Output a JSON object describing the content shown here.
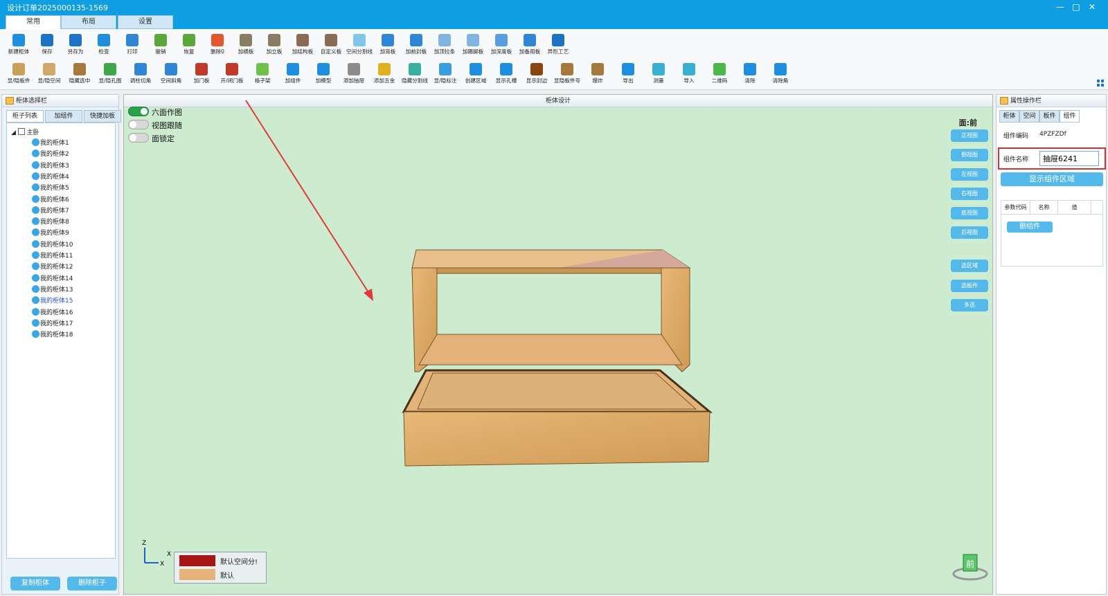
{
  "window": {
    "title": "设计订单2025000135-1569",
    "min": "—",
    "max": "□",
    "close": "✕"
  },
  "ribbon": {
    "tabs": [
      "常用",
      "布局",
      "设置"
    ],
    "row1": [
      {
        "label": "新建柜体",
        "color": "#1e8fe0"
      },
      {
        "label": "保存",
        "color": "#1b73c8"
      },
      {
        "label": "另存为",
        "color": "#1b73c8"
      },
      {
        "label": "检查",
        "color": "#1e8fe0"
      },
      {
        "label": "打印",
        "color": "#2f86d6"
      },
      {
        "label": "撤销",
        "color": "#5aa83a"
      },
      {
        "label": "恢复",
        "color": "#5aa83a"
      },
      {
        "label": "删除0",
        "color": "#e4572e"
      },
      {
        "label": "加横板",
        "color": "#8a7b63"
      },
      {
        "label": "加立板",
        "color": "#8a7b63"
      },
      {
        "label": "加结构板",
        "color": "#8a6b53"
      },
      {
        "label": "自定义板",
        "color": "#8a6b53"
      },
      {
        "label": "空间分割线",
        "color": "#7fc6ea"
      },
      {
        "label": "加背板",
        "color": "#2f86d6"
      },
      {
        "label": "加前封板",
        "color": "#2f86d6"
      },
      {
        "label": "加顶拉条",
        "color": "#7fb5e0"
      },
      {
        "label": "加踢脚板",
        "color": "#7fb5e0"
      },
      {
        "label": "加深度板",
        "color": "#5a9de0"
      },
      {
        "label": "加备用板",
        "color": "#2f86d6"
      },
      {
        "label": "异形工艺",
        "color": "#1b73c8"
      }
    ],
    "row2": [
      {
        "label": "显/隐板件",
        "color": "#c8a05a"
      },
      {
        "label": "显/隐空间",
        "color": "#d2a86a"
      },
      {
        "label": "隐藏选中",
        "color": "#a57a3e"
      },
      {
        "label": "显/隐孔图",
        "color": "#3ca84a"
      },
      {
        "label": "调柱切角",
        "color": "#2f86d6"
      },
      {
        "label": "空间斜角",
        "color": "#2f86d6"
      },
      {
        "label": "加门板",
        "color": "#c0392b"
      },
      {
        "label": "开/闭门板",
        "color": "#c0392b"
      },
      {
        "label": "格子架",
        "color": "#6ec14a"
      },
      {
        "label": "加组件",
        "color": "#1e8fe0"
      },
      {
        "label": "加模型",
        "color": "#1e8fe0"
      },
      {
        "label": "添加抽屉",
        "color": "#8c8c8c"
      },
      {
        "label": "添加五金",
        "color": "#e0b020"
      },
      {
        "label": "隐藏分割线",
        "color": "#3ab0a0"
      },
      {
        "label": "显/隐标注",
        "color": "#3a9de0"
      },
      {
        "label": "创建区域",
        "color": "#1e8fe0"
      },
      {
        "label": "显示孔槽",
        "color": "#1e8fe0"
      },
      {
        "label": "显示封边",
        "color": "#8b4513"
      },
      {
        "label": "显隐板件号",
        "color": "#a57a3e"
      },
      {
        "label": "爆炸",
        "color": "#a57a3e"
      },
      {
        "label": "导出",
        "color": "#1e8fe0"
      },
      {
        "label": "测量",
        "color": "#3ab0d0"
      },
      {
        "label": "导入",
        "color": "#3ab0d0"
      },
      {
        "label": "二维码",
        "color": "#4ab84a"
      },
      {
        "label": "清除",
        "color": "#1e8fe0"
      },
      {
        "label": "清除角",
        "color": "#1e8fe0"
      }
    ]
  },
  "left": {
    "header": "柜体选择栏",
    "tabs": [
      "柜子列表",
      "加组件",
      "快捷加板"
    ],
    "root": "主卧",
    "items": [
      "我的柜体1",
      "我的柜体2",
      "我的柜体3",
      "我的柜体4",
      "我的柜体5",
      "我的柜体6",
      "我的柜体7",
      "我的柜体8",
      "我的柜体9",
      "我的柜体10",
      "我的柜体11",
      "我的柜体12",
      "我的柜体14",
      "我的柜体13",
      "我的柜体15",
      "我的柜体16",
      "我的柜体17",
      "我的柜体18"
    ],
    "selected_index": 14,
    "copy_btn": "复制柜体",
    "delete_btn": "删除柜子"
  },
  "center": {
    "header": "柜体设计",
    "toggles": [
      {
        "label": "六面作图",
        "on": true
      },
      {
        "label": "视图跟随",
        "on": false
      },
      {
        "label": "面锁定",
        "on": false
      }
    ],
    "face": "面:前",
    "view_buttons": [
      "正视图",
      "侧视图",
      "左视图",
      "右视图",
      "底视图",
      "后视图"
    ],
    "select_buttons": [
      "选区域",
      "选板件",
      "多选"
    ],
    "legend": [
      {
        "label": "默认空间分!",
        "color": "#a81515"
      },
      {
        "label": "默认",
        "color": "#e6b47a"
      }
    ],
    "axis": {
      "z": "Z",
      "x": "X"
    },
    "front_label": "前"
  },
  "right": {
    "header": "属性操作栏",
    "tabs": [
      "柜体",
      "空间",
      "板件",
      "组件"
    ],
    "active_tab": 3,
    "code_label": "组件编码",
    "code_value": "4PZFZDf",
    "name_label": "组件名称",
    "name_value": "抽屉6241",
    "show_region": "显示组件区域",
    "table_headers": [
      "参数代码",
      "名称",
      "值"
    ],
    "delete_component": "删组件"
  }
}
